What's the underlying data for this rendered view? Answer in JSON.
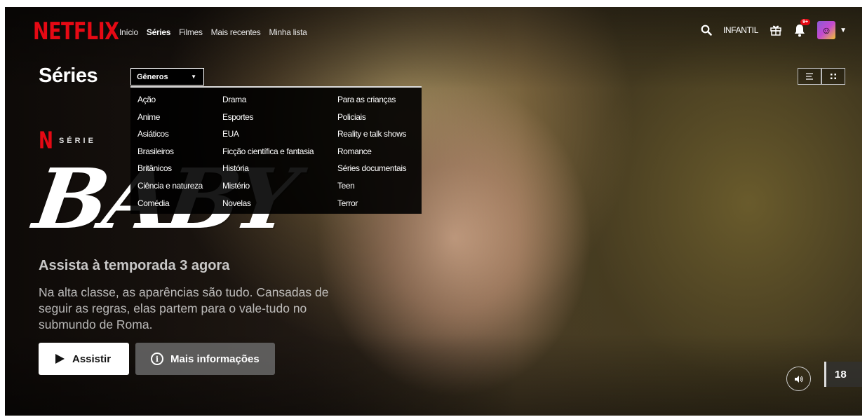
{
  "header": {
    "logo": "NETFLIX",
    "nav": [
      "Início",
      "Séries",
      "Filmes",
      "Mais recentes",
      "Minha lista"
    ],
    "active_nav": "Séries",
    "kids_label": "INFANTIL",
    "notification_badge": "9+"
  },
  "subheader": {
    "title": "Séries",
    "genre_button": "Gêneros"
  },
  "genres": {
    "col1": [
      "Ação",
      "Anime",
      "Asiáticos",
      "Brasileiros",
      "Britânicos",
      "Ciência e natureza",
      "Comédia"
    ],
    "col2": [
      "Drama",
      "Esportes",
      "EUA",
      "Ficção científica e fantasia",
      "História",
      "Mistério",
      "Novelas"
    ],
    "col3": [
      "Para as crianças",
      "Policiais",
      "Reality e talk shows",
      "Romance",
      "Séries documentais",
      "Teen",
      "Terror"
    ]
  },
  "hero": {
    "n_mark": "N",
    "series_label": "SÉRIE",
    "show_logo_text": "BABY",
    "season_line": "Assista à temporada 3 agora",
    "synopsis": "Na alta classe, as aparências são tudo. Cansadas de seguir as regras, elas partem para o vale-tudo no submundo de Roma.",
    "play_label": "Assistir",
    "info_label": "Mais informações",
    "maturity_rating": "18"
  },
  "colors": {
    "brand_red": "#e50914",
    "dropdown_bg": "#000000"
  },
  "icons": [
    "search-icon",
    "gift-icon",
    "bell-icon",
    "avatar",
    "chevron-down-icon",
    "list-view-icon",
    "grid-view-icon",
    "play-icon",
    "info-icon",
    "volume-icon"
  ]
}
